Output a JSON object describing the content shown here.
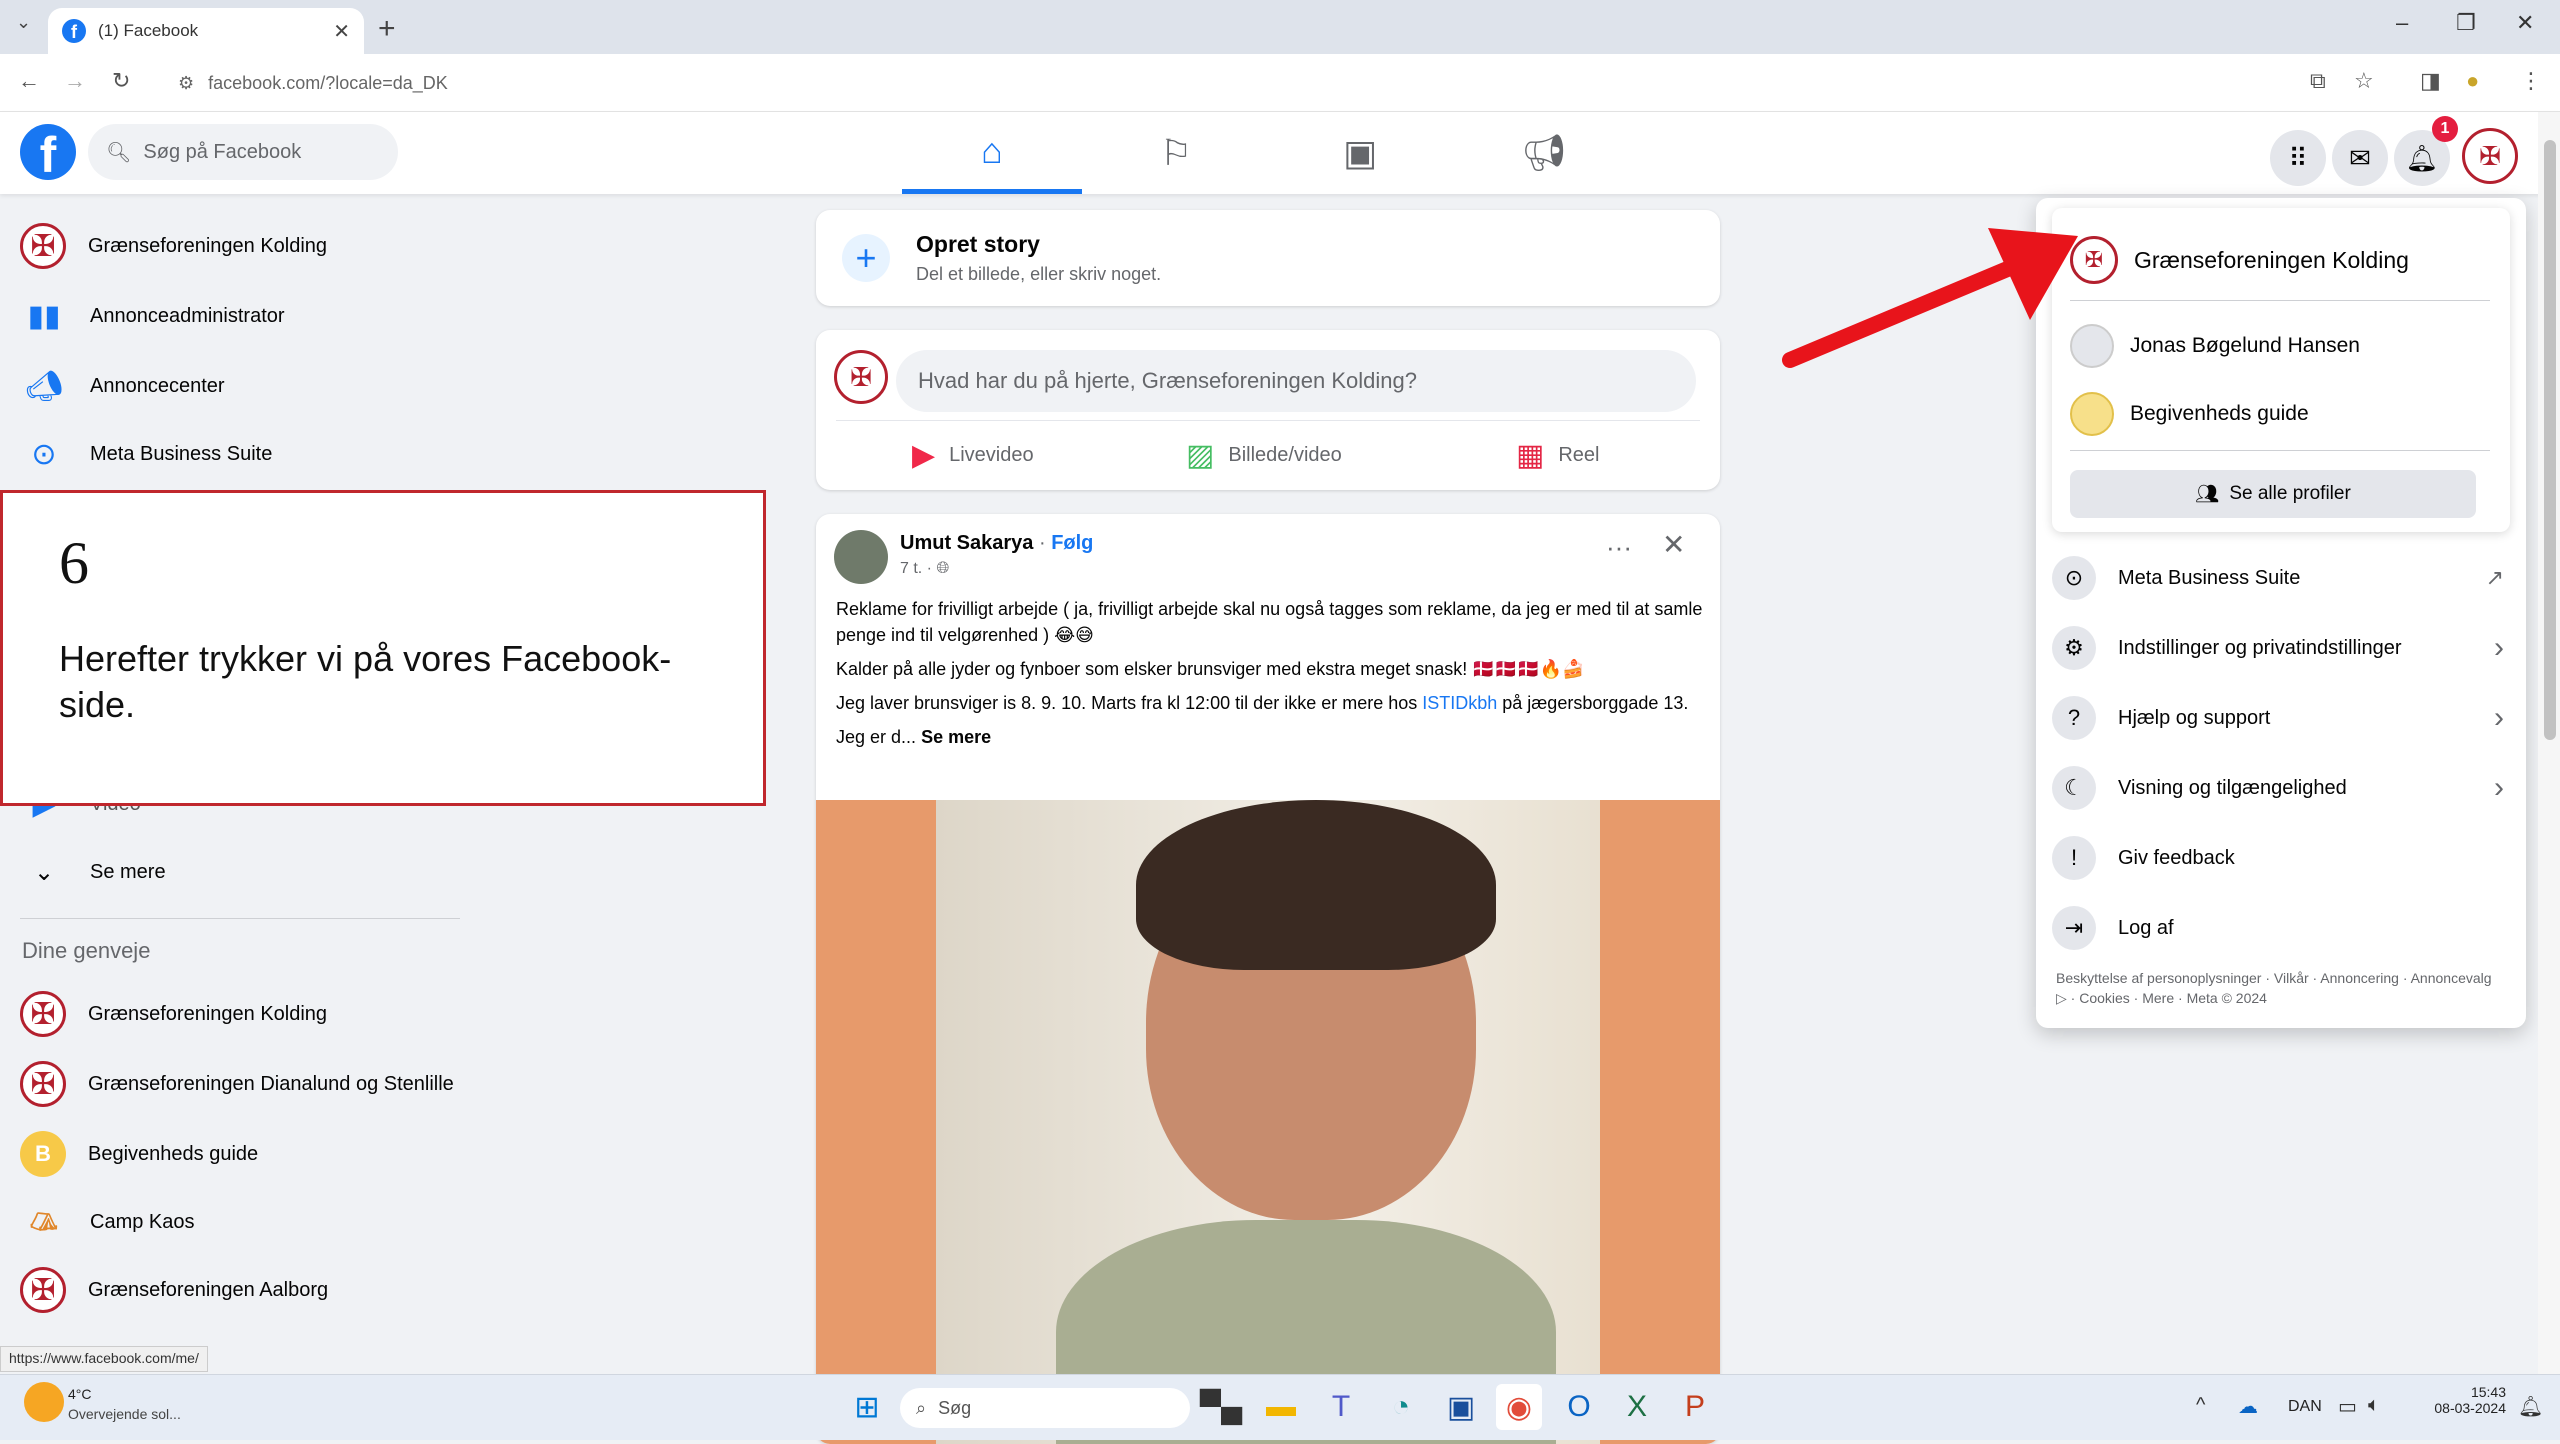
{
  "browser": {
    "tab_title": "(1) Facebook",
    "url": "facebook.com/?locale=da_DK"
  },
  "fb": {
    "search_placeholder": "Søg på Facebook",
    "notification_count": "1"
  },
  "left_sidebar": {
    "items": [
      {
        "label": "Grænseforeningen Kolding",
        "icon": "page-crest-icon"
      },
      {
        "label": "Annonceadministrator",
        "icon": "bar-chart-icon"
      },
      {
        "label": "Annoncecenter",
        "icon": "megaphone-icon"
      },
      {
        "label": "Meta Business Suite",
        "icon": "meta-business-icon"
      }
    ],
    "partial_item": "Video",
    "see_more": "Se mere",
    "shortcuts_heading": "Dine genveje",
    "shortcuts": [
      {
        "label": "Grænseforeningen Kolding"
      },
      {
        "label": "Grænseforeningen Dianalund og Stenlille"
      },
      {
        "label": "Begivenheds guide",
        "letter": "B"
      },
      {
        "label": "Camp Kaos"
      },
      {
        "label": "Grænseforeningen Aalborg"
      }
    ]
  },
  "instruction": {
    "step": "6",
    "text": "Herefter trykker vi på vores Facebook-side."
  },
  "feed": {
    "story_title": "Opret story",
    "story_subtitle": "Del et billede, eller skriv noget.",
    "composer_placeholder": "Hvad har du på hjerte, Grænseforeningen Kolding?",
    "composer_buttons": [
      "Livevideo",
      "Billede/video",
      "Reel"
    ],
    "post": {
      "author": "Umut Sakarya",
      "follow": "Følg",
      "time": "7 t. ·",
      "p1": "Reklame for frivilligt arbejde ( ja, frivilligt arbejde skal nu også tagges som reklame, da jeg er med til at samle penge ind til velgørenhed ) 😂😅",
      "p2": "Kalder på alle jyder og fynboer som elsker brunsviger med ekstra meget snask! 🇩🇰🇩🇰🇩🇰🔥🍰",
      "p3_a": "Jeg laver brunsviger is 8. 9. 10. Marts fra kl 12:00 til der ikke er mere hos ",
      "p3_link": "ISTIDkbh",
      "p3_b": " på jægersborggade 13.",
      "p4": "Jeg er d...",
      "see_more": "Se mere"
    }
  },
  "account_menu": {
    "profiles": [
      {
        "name": "Grænseforeningen Kolding"
      },
      {
        "name": "Jonas Bøgelund Hansen"
      },
      {
        "name": "Begivenheds guide"
      }
    ],
    "see_all_profiles": "Se alle profiler",
    "items": [
      {
        "label": "Meta Business Suite",
        "trail": "↗"
      },
      {
        "label": "Indstillinger og privatindstillinger",
        "trail": "›"
      },
      {
        "label": "Hjælp og support",
        "trail": "›"
      },
      {
        "label": "Visning og tilgængelighed",
        "trail": "›"
      },
      {
        "label": "Giv feedback",
        "trail": ""
      },
      {
        "label": "Log af",
        "trail": ""
      }
    ],
    "footer": "Beskyttelse af personoplysninger · Vilkår · Annoncering · Annoncevalg ▷ · Cookies · Mere · Meta © 2024"
  },
  "status_url": "https://www.facebook.com/me/",
  "taskbar": {
    "weather_temp": "4°C",
    "weather_desc": "Overvejende sol...",
    "search": "Søg",
    "lang": "DAN",
    "time": "15:43",
    "date": "08-03-2024"
  },
  "colors": {
    "fb_blue": "#1877f2",
    "annotation_red": "#e8141b",
    "crest_red": "#b3202e"
  }
}
